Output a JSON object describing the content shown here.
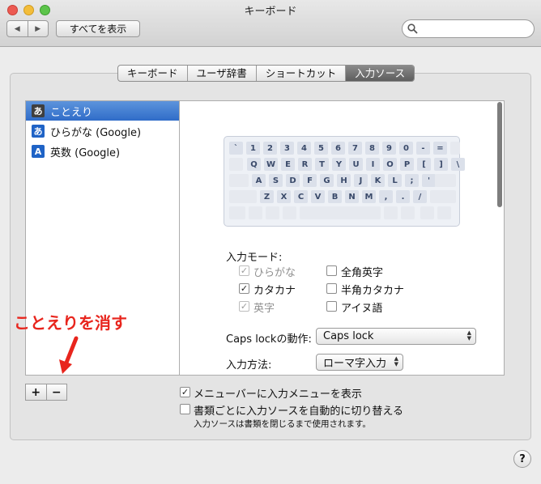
{
  "window": {
    "title": "キーボード"
  },
  "toolbar": {
    "back": "◀",
    "forward": "▶",
    "show_all": "すべてを表示",
    "search_value": ""
  },
  "tabs": [
    {
      "label": "キーボード",
      "active": false
    },
    {
      "label": "ユーザ辞書",
      "active": false
    },
    {
      "label": "ショートカット",
      "active": false
    },
    {
      "label": "入力ソース",
      "active": true
    }
  ],
  "sources": [
    {
      "icon": "あ",
      "label": "ことえり",
      "selected": true,
      "icon_color": "#3f3f3f"
    },
    {
      "icon": "あ",
      "label": "ひらがな (Google)",
      "selected": false,
      "icon_color": "#1f63c6"
    },
    {
      "icon": "A",
      "label": "英数 (Google)",
      "selected": false,
      "icon_color": "#1f63c6"
    }
  ],
  "keyboard": {
    "rows": [
      [
        "`",
        "1",
        "2",
        "3",
        "4",
        "5",
        "6",
        "7",
        "8",
        "9",
        "0",
        "-",
        "="
      ],
      [
        "Q",
        "W",
        "E",
        "R",
        "T",
        "Y",
        "U",
        "I",
        "O",
        "P",
        "[",
        "]",
        "\\"
      ],
      [
        "A",
        "S",
        "D",
        "F",
        "G",
        "H",
        "J",
        "K",
        "L",
        ";",
        "'"
      ],
      [
        "Z",
        "X",
        "C",
        "V",
        "B",
        "N",
        "M",
        ",",
        ".",
        "/"
      ]
    ]
  },
  "input_mode": {
    "label": "入力モード:",
    "options": [
      {
        "label": "ひらがな",
        "checked": true,
        "enabled": false
      },
      {
        "label": "全角英字",
        "checked": false,
        "enabled": true
      },
      {
        "label": "カタカナ",
        "checked": true,
        "enabled": true
      },
      {
        "label": "半角カタカナ",
        "checked": false,
        "enabled": true
      },
      {
        "label": "英字",
        "checked": true,
        "enabled": false
      },
      {
        "label": "アイヌ語",
        "checked": false,
        "enabled": true
      }
    ]
  },
  "caps_lock": {
    "label": "Caps lockの動作:",
    "value": "Caps lock"
  },
  "input_method": {
    "label": "入力方法:",
    "value": "ローマ字入力"
  },
  "list_buttons": {
    "add": "+",
    "remove": "−"
  },
  "bottom": {
    "show_menu": {
      "label": "メニューバーに入力メニューを表示",
      "checked": true
    },
    "auto_switch": {
      "label": "書類ごとに入力ソースを自動的に切り替える",
      "checked": false
    },
    "note": "入力ソースは書類を閉じるまで使用されます。"
  },
  "annotation": {
    "text": "ことえりを消す",
    "color": "#e8251d"
  },
  "help": "?"
}
